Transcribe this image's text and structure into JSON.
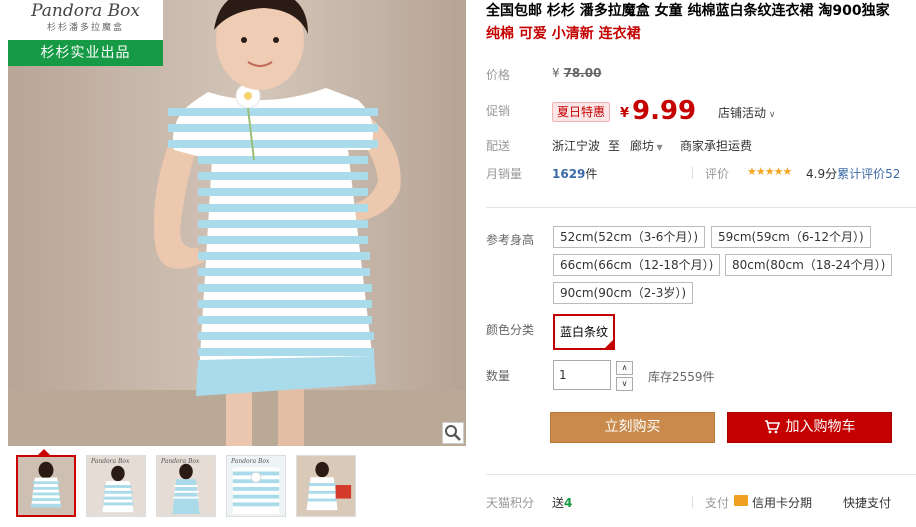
{
  "gallery": {
    "brand_name": "Pandora Box",
    "brand_cn": "杉杉潘多拉魔盒",
    "brand_bar": "杉杉实业出品",
    "zoom_icon": "magnifier-icon",
    "thumbnails": [
      {
        "brand": "",
        "active": true
      },
      {
        "brand": "Pandora Box",
        "active": false
      },
      {
        "brand": "Pandora Box",
        "active": false
      },
      {
        "brand": "Pandora Box",
        "active": false
      },
      {
        "brand": "",
        "active": false
      }
    ]
  },
  "product": {
    "title": "全国包邮 杉杉 潘多拉魔盒 女童 纯棉蓝白条纹连衣裙 淘900独家",
    "subtitle": "纯棉 可爱 小清新 连衣裙"
  },
  "price": {
    "label": "价格",
    "currency": "¥",
    "original": "78.00"
  },
  "promo": {
    "label": "促销",
    "tag": "夏日特惠",
    "currency": "¥",
    "price": "9.99",
    "shop_activity": "店铺活动"
  },
  "shipping": {
    "label": "配送",
    "from": "浙江宁波",
    "to_word": "至",
    "to": "廊坊",
    "note": "商家承担运费"
  },
  "sales": {
    "label": "月销量",
    "count": "1629",
    "unit": "件",
    "review_label": "评价",
    "stars": "★★★★★",
    "rating": "4.9分",
    "review_text": "累计评价",
    "review_count": "52"
  },
  "options": {
    "size_label": "参考身高",
    "sizes": [
      "52cm(52cm（3-6个月）)",
      "59cm(59cm（6-12个月）)",
      "66cm(66cm（12-18个月）)",
      "80cm(80cm（18-24个月）)",
      "90cm(90cm（2-3岁）)"
    ],
    "color_label": "颜色分类",
    "color_selected": "蓝白条纹",
    "qty_label": "数量",
    "qty_value": "1",
    "stock": "库存2559件"
  },
  "actions": {
    "buy": "立刻购买",
    "cart": "加入购物车",
    "cart_icon": "cart-icon"
  },
  "footer": {
    "points_label": "天猫积分",
    "points_prefix": "送",
    "points_value": "4",
    "pay_label": "支付",
    "credit": "信用卡分期",
    "quick_pay": "快捷支付"
  },
  "colors": {
    "accent_red": "#c40000",
    "buy_button": "#c98a4b",
    "brand_green": "#179a45",
    "dress_blue": "#a9dbea"
  }
}
